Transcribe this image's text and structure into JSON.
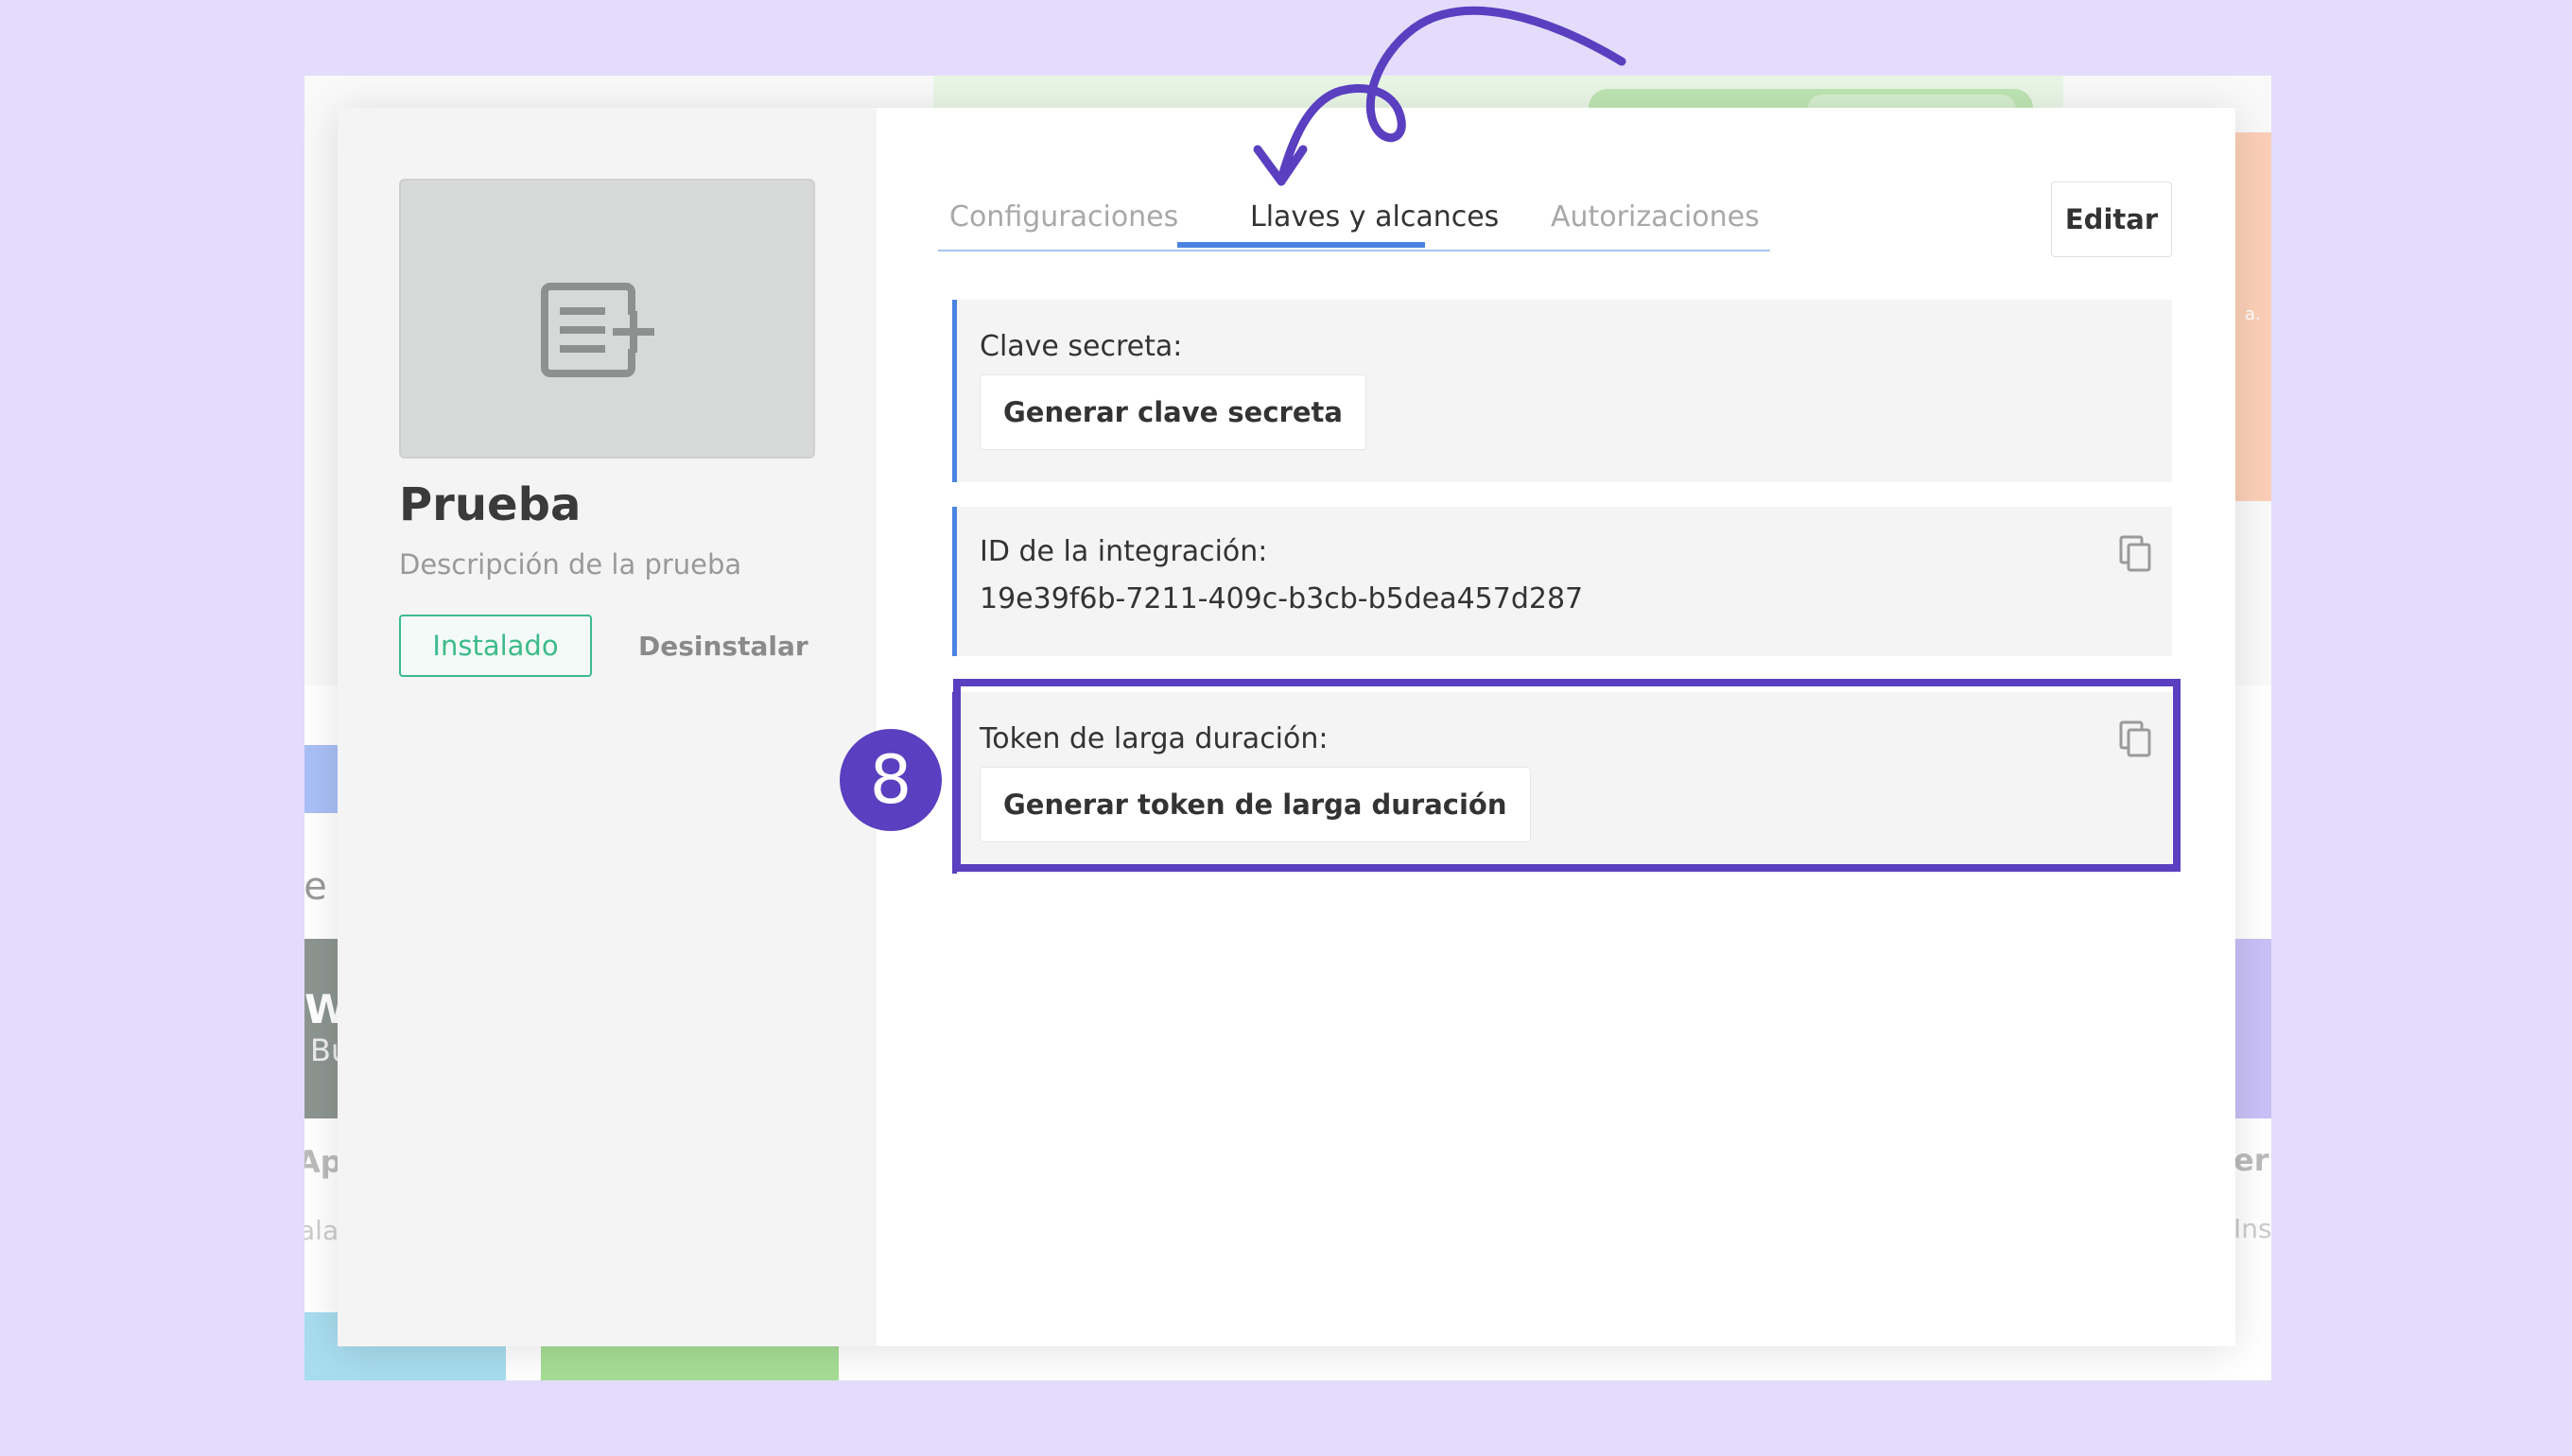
{
  "background": {
    "left_tile_text": "je",
    "dark_tile_text_1": "W",
    "dark_tile_text_2": "Bu",
    "left_app_text": "App",
    "left_status_text": "alac",
    "right_app_text": "er",
    "right_status_text": "Ins",
    "orange_text": "a."
  },
  "sidebar": {
    "thumbnail_icon": "add-list-icon",
    "title": "Prueba",
    "description": "Descripción de la prueba",
    "installed_label": "Instalado",
    "uninstall_label": "Desinstalar"
  },
  "tabs": [
    {
      "label": "Configuraciones",
      "active": false
    },
    {
      "label": "Llaves y alcances",
      "active": true
    },
    {
      "label": "Autorizaciones",
      "active": false
    }
  ],
  "edit_label": "Editar",
  "cards": {
    "secret": {
      "label": "Clave secreta:",
      "button_label": "Generar clave secreta"
    },
    "integration": {
      "label": "ID de la integración:",
      "value": "19e39f6b-7211-409c-b3cb-b5dea457d287",
      "icon": "copy-icon"
    },
    "token": {
      "label": "Token de larga duración:",
      "button_label": "Generar token de larga duración",
      "icon": "copy-icon"
    }
  },
  "annotation": {
    "step_number": "8",
    "color": "#5a3fc0"
  },
  "colors": {
    "accent_blue": "#4b83e2",
    "installed_green": "#3dbb8c",
    "annotation_purple": "#5a3fc0",
    "page_background": "#e3ddfb"
  }
}
